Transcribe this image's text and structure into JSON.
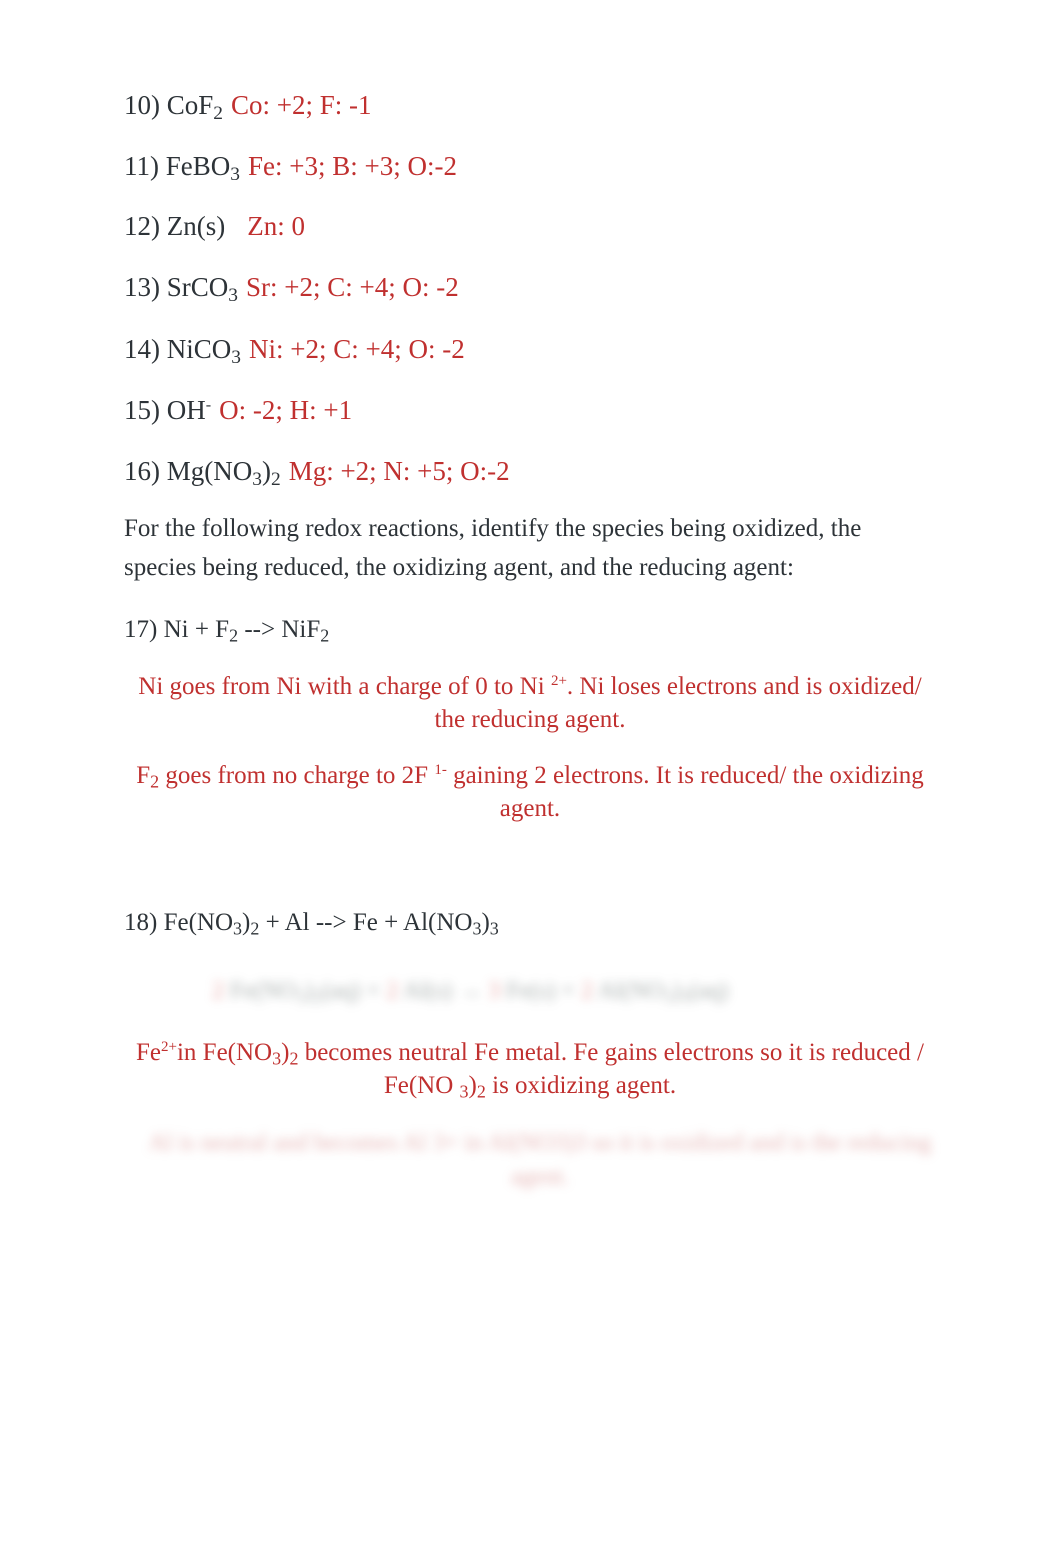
{
  "colors": {
    "text": "#2d3338",
    "answer": "#c0302f"
  },
  "oxidation_numbers": [
    {
      "num": "10)",
      "formula": [
        {
          "t": "CoF"
        },
        {
          "sub": "2"
        }
      ],
      "answer": "Co: +2; F: -1"
    },
    {
      "num": "11)",
      "formula": [
        {
          "t": "FeBO"
        },
        {
          "sub": "3"
        }
      ],
      "answer": "Fe: +3; B: +3; O:-2"
    },
    {
      "num": "12)",
      "formula": [
        {
          "t": "Zn(s)"
        }
      ],
      "answer": "Zn: 0"
    },
    {
      "num": "13)",
      "formula": [
        {
          "t": "SrCO"
        },
        {
          "sub": "3"
        }
      ],
      "answer": "Sr: +2; C: +4; O: -2"
    },
    {
      "num": "14)",
      "formula": [
        {
          "t": "NiCO"
        },
        {
          "sub": "3"
        }
      ],
      "answer": "Ni: +2; C: +4; O: -2"
    },
    {
      "num": "15)",
      "formula": [
        {
          "t": "OH"
        },
        {
          "sup": "-"
        }
      ],
      "answer": "O: -2; H: +1"
    },
    {
      "num": "16)",
      "formula": [
        {
          "t": "Mg(NO"
        },
        {
          "sub": "3"
        },
        {
          "t": ")"
        },
        {
          "sub": "2"
        }
      ],
      "answer": "Mg: +2; N: +5; O:-2"
    }
  ],
  "instructions": "For the following redox reactions, identify the species being oxidized, the species being reduced, the oxidizing agent, and the reducing agent:",
  "q17": {
    "label": "17) Ni + F",
    "sub1": "2",
    "arrow": " --> NiF",
    "sub2": "2",
    "answer1": {
      "a": "Ni goes from Ni with a charge of 0 to Ni ",
      "sup": "2+",
      "b": ". Ni loses electrons and is oxidized/ the reducing agent."
    },
    "answer2": {
      "a": "F",
      "sub": "2",
      "b": " goes from no charge to 2F ",
      "sup": "1-",
      "c": "  gaining 2 electrons. It is reduced/ the oxidizing agent."
    }
  },
  "q18": {
    "label": "18) Fe(NO",
    "sub1": "3",
    "p1": ")",
    "sub2": "2",
    "mid": " + Al --> Fe + Al(NO",
    "sub3": "3",
    "p2": ")",
    "sub4": "3",
    "blurred_equation": "[obscured]",
    "answer1": {
      "a": "Fe",
      "sup": "2+",
      "b": "in Fe(NO",
      "sub1": "3",
      "c": ")",
      "sub2": "2",
      "d": " becomes neutral Fe metal. Fe gains electrons so it is reduced / Fe(NO ",
      "sub3": "3",
      "e": ")",
      "sub4": "2",
      "f": " is oxidizing agent."
    },
    "blurred_answer2": "[obscured]"
  }
}
